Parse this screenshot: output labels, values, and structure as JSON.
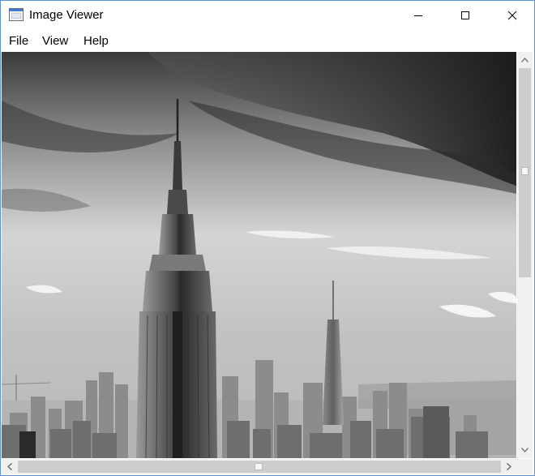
{
  "window": {
    "title": "Image Viewer",
    "icon": "app-window-icon",
    "controls": [
      "minimize-icon",
      "maximize-icon",
      "close-icon"
    ]
  },
  "menu": {
    "items": [
      {
        "label": "File"
      },
      {
        "label": "View"
      },
      {
        "label": "Help"
      }
    ]
  },
  "image": {
    "subject": "black-and-white city skyline photo",
    "palette": "grayscale"
  },
  "scrollbars": {
    "vertical": {
      "position_fraction": 0.0
    },
    "horizontal": {
      "position_fraction": 0.0
    }
  },
  "colors": {
    "window_border": "#5a8fd8",
    "scrollbar_track": "#f0f0f0",
    "scrollbar_thumb": "#cdcdcd"
  }
}
